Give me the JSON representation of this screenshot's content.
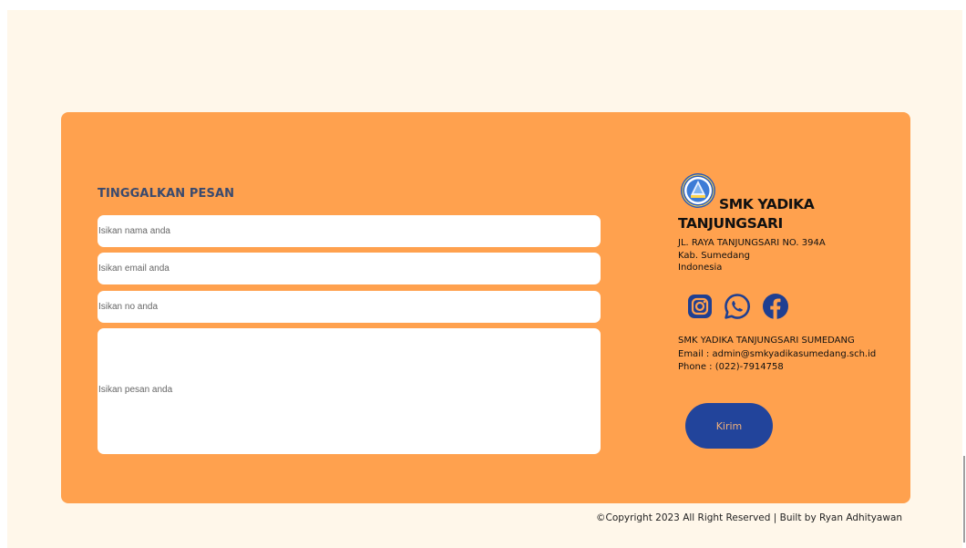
{
  "form": {
    "title": "TINGGALKAN PESAN",
    "name_placeholder": "Isikan nama anda",
    "email_placeholder": "Isikan email anda",
    "phone_placeholder": "Isikan no anda",
    "message_placeholder": "Isikan pesan anda",
    "submit_label": "Kirim"
  },
  "school": {
    "name": "SMK YADIKA TANJUNGSARI",
    "address_line1": "JL. RAYA TANJUNGSARI NO. 394A",
    "address_line2": "Kab. Sumedang",
    "address_line3": "Indonesia",
    "logo_icon": "school-logo-icon"
  },
  "socials": [
    {
      "icon": "instagram-icon"
    },
    {
      "icon": "whatsapp-icon"
    },
    {
      "icon": "facebook-icon"
    }
  ],
  "contact": {
    "org": "SMK YADIKA TANJUNGSARI SUMEDANG",
    "email": "Email : admin@smkyadikasumedang.sch.id",
    "phone": "Phone : (022)-7914758"
  },
  "footer": {
    "copyright": "©Copyright 2023 All Right Reserved | Built by Ryan Adhityawan"
  },
  "colors": {
    "card": "#ffa14e",
    "page": "#fff7ea",
    "button": "#22449b",
    "icons": "#1f3f91"
  }
}
